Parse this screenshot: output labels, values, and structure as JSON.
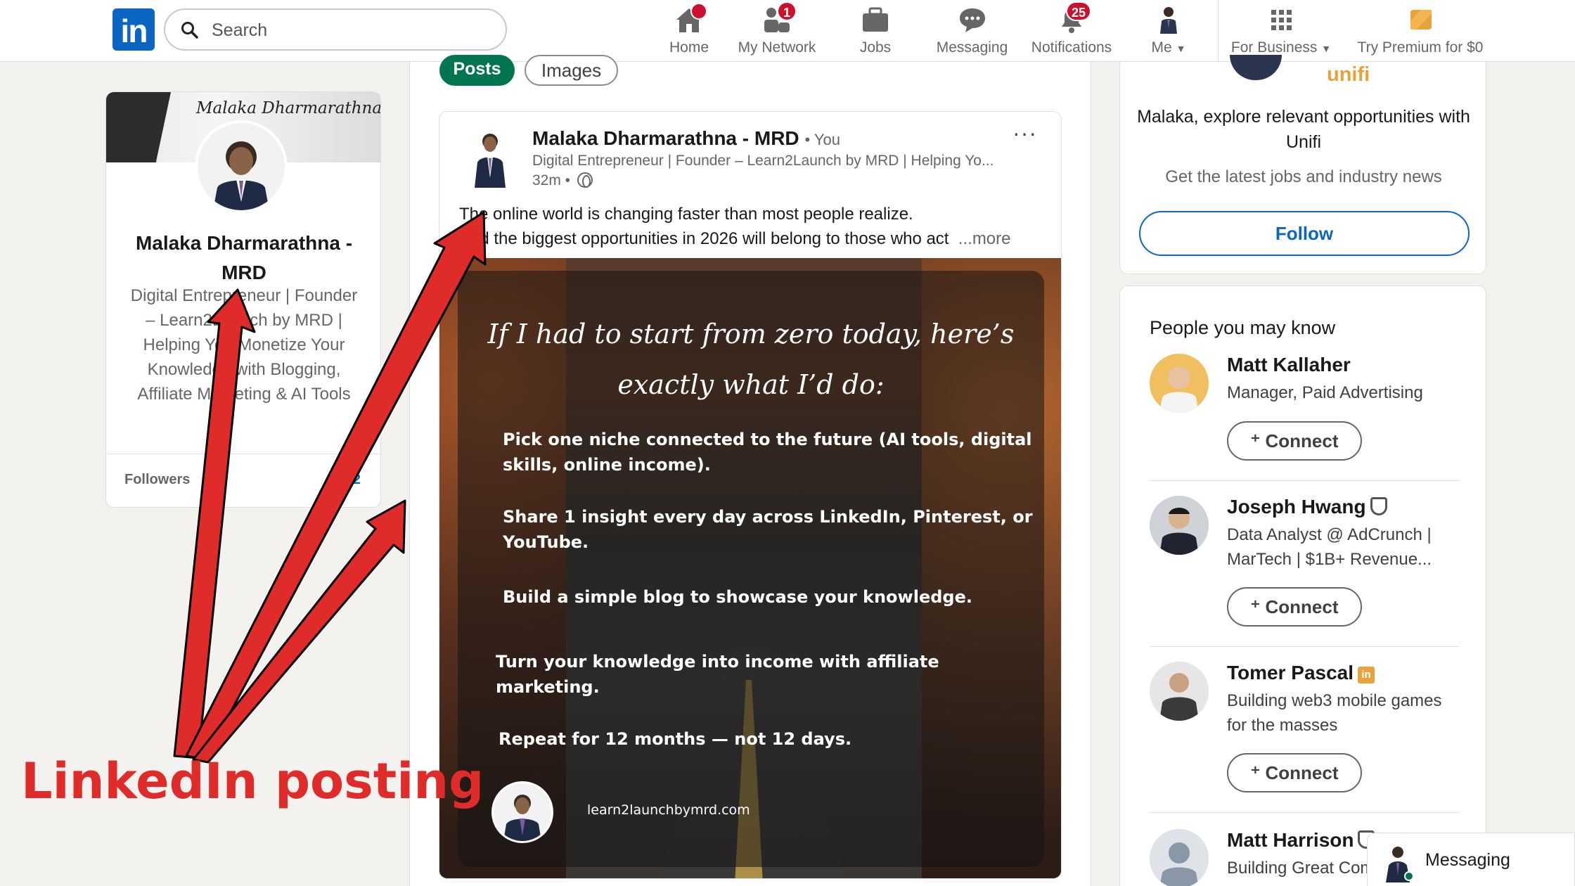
{
  "nav": {
    "search_placeholder": "Search",
    "items": [
      {
        "label": "Home",
        "icon": "home-icon",
        "badge": ""
      },
      {
        "label": "My Network",
        "icon": "network-icon",
        "badge": "1"
      },
      {
        "label": "Jobs",
        "icon": "briefcase-icon",
        "badge": ""
      },
      {
        "label": "Messaging",
        "icon": "chat-icon",
        "badge": ""
      },
      {
        "label": "Notifications",
        "icon": "bell-icon",
        "badge": "25"
      },
      {
        "label": "Me",
        "icon": "avatar",
        "badge": ""
      },
      {
        "label": "For Business",
        "icon": "grid-icon",
        "badge": ""
      },
      {
        "label": "Try Premium for $0",
        "icon": "premium-icon",
        "badge": ""
      }
    ]
  },
  "profile": {
    "banner_text": "Malaka Dharmarathna MRD",
    "name": "Malaka Dharmarathna - MRD",
    "headline": "Digital Entrepreneur | Founder – Learn2Launch by MRD | Helping You Monetize Your Knowledge with Blogging, Affiliate Marketing & AI Tools",
    "followers_label": "Followers",
    "followers_count": "2"
  },
  "tabs": {
    "posts": "Posts",
    "images": "Images"
  },
  "post": {
    "author": "Malaka Dharmarathna - MRD",
    "you": "• You",
    "subtitle": "Digital Entrepreneur | Founder – Learn2Launch by MRD | Helping Yo...",
    "time": "32m •",
    "more_menu": "···",
    "text_line1": "The online world is changing faster than most people realize.",
    "text_line2": "And the biggest opportunities in 2026 will belong to those who act",
    "more_link": "...more",
    "image": {
      "title_line1": "If I had to start from zero today, here’s",
      "title_line2": "exactly what I’d do:",
      "points": [
        "Pick one niche connected to the future (AI tools, digital skills, online income).",
        "Share 1 insight every day across LinkedIn, Pinterest, or YouTube.",
        "Build a simple blog to showcase your knowledge.",
        "Turn your knowledge into income with affiliate marketing.",
        "Repeat for 12 months — not 12 days."
      ],
      "url": "learn2launchbymrd.com"
    }
  },
  "ad": {
    "brand": "unifi",
    "title": "Malaka, explore relevant opportunities with Unifi",
    "subtitle": "Get the latest jobs and industry news",
    "follow": "Follow"
  },
  "pymk": {
    "title": "People you may know",
    "connect": "Connect",
    "people": [
      {
        "name": "Matt Kallaher",
        "headline": "Manager, Paid Advertising"
      },
      {
        "name": "Joseph Hwang",
        "headline": "Data Analyst @ AdCrunch | MarTech | $1B+ Revenue..."
      },
      {
        "name": "Tomer Pascal",
        "headline": "Building web3 mobile games for the masses"
      },
      {
        "name": "Matt Harrison",
        "headline": "Building Great Com"
      }
    ]
  },
  "messaging": {
    "label": "Messaging"
  },
  "annotation": {
    "label": "LinkedIn posting",
    "color": "#e02b2b"
  }
}
